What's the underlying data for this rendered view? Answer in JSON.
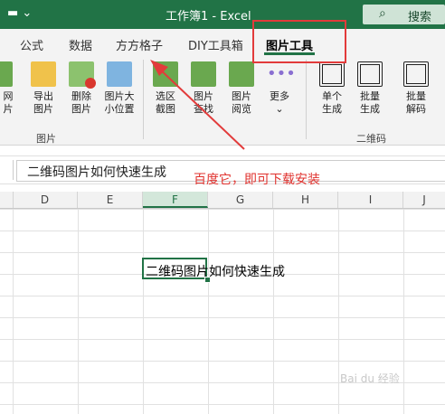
{
  "window": {
    "title": "工作簿1  -  Excel",
    "qat_icon": "customize-dropdown-icon",
    "search_label": "搜索"
  },
  "tabs": [
    "公式",
    "数据",
    "方方格子",
    "DIY工具箱",
    "图片工具"
  ],
  "active_tab": "图片工具",
  "ribbon": {
    "buttons": [
      {
        "l1": "网",
        "l2": "片"
      },
      {
        "l1": "导出",
        "l2": "图片"
      },
      {
        "l1": "删除",
        "l2": "图片"
      },
      {
        "l1": "图片大",
        "l2": "小位置"
      },
      {
        "l1": "选区",
        "l2": "截图"
      },
      {
        "l1": "图片",
        "l2": "查找"
      },
      {
        "l1": "图片",
        "l2": "阅览"
      },
      {
        "l1": "更多",
        "l2": "⌄"
      },
      {
        "l1": "单个",
        "l2": "生成"
      },
      {
        "l1": "批量",
        "l2": "生成"
      },
      {
        "l1": "批量",
        "l2": "解码"
      }
    ],
    "groups": [
      "图片",
      "二维码"
    ]
  },
  "formula_bar": {
    "content": "二维码图片如何快速生成"
  },
  "annotation": "百度它，即可下载安装",
  "columns": [
    "D",
    "E",
    "F",
    "G",
    "H",
    "I",
    "J"
  ],
  "selected_column": "F",
  "active_cell_text": "二维码图片如何快速生成",
  "colors": {
    "excel_green": "#217346",
    "annotation_red": "#e23b3b"
  },
  "watermark": "Bai du 经验"
}
